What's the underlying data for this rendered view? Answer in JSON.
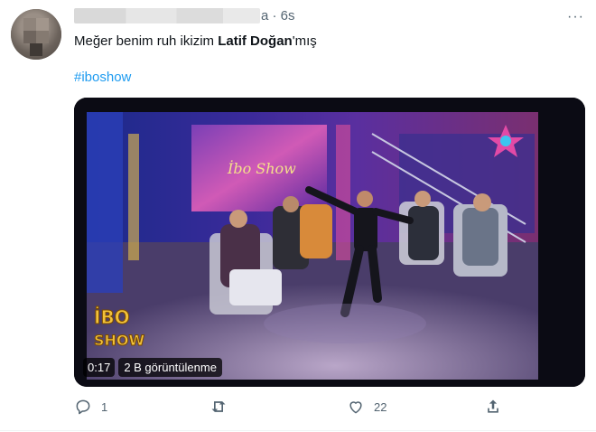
{
  "tweet": {
    "author_time": "a · 6s",
    "text_before": "Meğer benim ruh ikizim ",
    "text_bold": "Latif Doğan",
    "text_after": "'mış",
    "hashtag": "#iboshow",
    "more_label": "···"
  },
  "video": {
    "duration": "0:17",
    "views": "2 B görüntülenme",
    "logo_line1": "İBO",
    "logo_line2": "SHOW",
    "backdrop_text": "İbo Show"
  },
  "actions": {
    "reply_icon": "reply-icon",
    "reply_count": "1",
    "retweet_icon": "retweet-icon",
    "retweet_count": "",
    "like_icon": "heart-icon",
    "like_count": "22",
    "share_icon": "share-icon"
  }
}
